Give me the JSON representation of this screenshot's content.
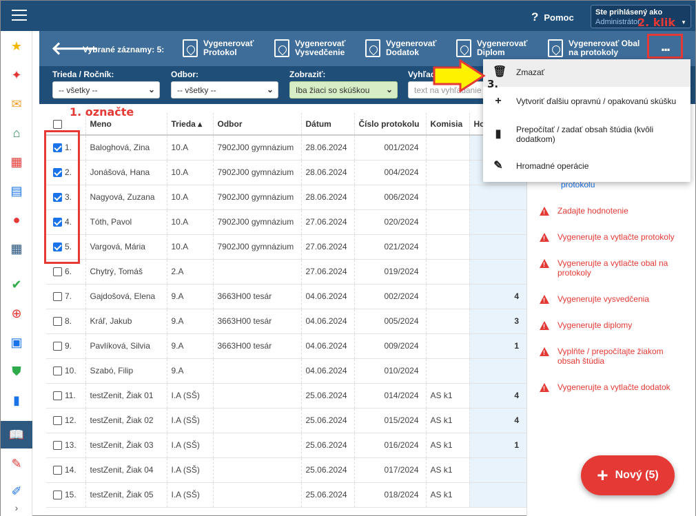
{
  "header": {
    "help_label": "Pomoc",
    "user_line1": "Ste prihlásený ako",
    "user_line2": "Administrátor"
  },
  "toolbar": {
    "selected_label": "Vybrané záznamy: 5:",
    "buttons": [
      {
        "l1": "Vygenerovať",
        "l2": "Protokol"
      },
      {
        "l1": "Vygenerovať",
        "l2": "Vysvedčenie"
      },
      {
        "l1": "Vygenerovať",
        "l2": "Dodatok"
      },
      {
        "l1": "Vygenerovať",
        "l2": "Diplom"
      },
      {
        "l1": "Vygenerovať Obal",
        "l2": "na protokoly"
      }
    ],
    "more_label": "..."
  },
  "filters": {
    "trieda_label": "Trieda / Ročník:",
    "trieda_value": "-- všetky --",
    "odbor_label": "Odbor:",
    "odbor_value": "-- všetky --",
    "zobrazit_label": "Zobraziť:",
    "zobrazit_value": "Iba žiaci so skúškou",
    "search_label": "Vyhľadá",
    "search_placeholder": "text na vyhľadanie"
  },
  "table": {
    "headers": {
      "meno": "Meno",
      "trieda": "Trieda ▴",
      "odbor": "Odbor",
      "datum": "Dátum",
      "cislo": "Číslo protokolu",
      "komisia": "Komisia",
      "ho": "Ho"
    },
    "rows": [
      {
        "n": "1.",
        "checked": true,
        "meno": "Baloghová, Zina",
        "trieda": "10.A",
        "odbor": "7902J00 gymnázium",
        "datum": "28.06.2024",
        "cislo": "001/2024",
        "komisia": "",
        "ho": ""
      },
      {
        "n": "2.",
        "checked": true,
        "meno": "Jonášová, Hana",
        "trieda": "10.A",
        "odbor": "7902J00 gymnázium",
        "datum": "28.06.2024",
        "cislo": "004/2024",
        "komisia": "",
        "ho": ""
      },
      {
        "n": "3.",
        "checked": true,
        "meno": "Nagyová, Zuzana",
        "trieda": "10.A",
        "odbor": "7902J00 gymnázium",
        "datum": "28.06.2024",
        "cislo": "006/2024",
        "komisia": "",
        "ho": ""
      },
      {
        "n": "4.",
        "checked": true,
        "meno": "Tóth, Pavol",
        "trieda": "10.A",
        "odbor": "7902J00 gymnázium",
        "datum": "27.06.2024",
        "cislo": "020/2024",
        "komisia": "",
        "ho": ""
      },
      {
        "n": "5.",
        "checked": true,
        "meno": "Vargová, Mária",
        "trieda": "10.A",
        "odbor": "7902J00 gymnázium",
        "datum": "27.06.2024",
        "cislo": "021/2024",
        "komisia": "",
        "ho": ""
      },
      {
        "n": "6.",
        "checked": false,
        "meno": "Chytrý, Tomáš",
        "trieda": "2.A",
        "odbor": "",
        "datum": "27.06.2024",
        "cislo": "019/2024",
        "komisia": "",
        "ho": ""
      },
      {
        "n": "7.",
        "checked": false,
        "meno": "Gajdošová, Elena",
        "trieda": "9.A",
        "odbor": "3663H00 tesár",
        "datum": "04.06.2024",
        "cislo": "002/2024",
        "komisia": "",
        "ho": "4"
      },
      {
        "n": "8.",
        "checked": false,
        "meno": "Kráľ, Jakub",
        "trieda": "9.A",
        "odbor": "3663H00 tesár",
        "datum": "04.06.2024",
        "cislo": "005/2024",
        "komisia": "",
        "ho": "3"
      },
      {
        "n": "9.",
        "checked": false,
        "meno": "Pavlíková, Silvia",
        "trieda": "9.A",
        "odbor": "3663H00 tesár",
        "datum": "04.06.2024",
        "cislo": "009/2024",
        "komisia": "",
        "ho": "1"
      },
      {
        "n": "10.",
        "checked": false,
        "meno": "Szabó, Filip",
        "trieda": "9.A",
        "odbor": "",
        "datum": "04.06.2024",
        "cislo": "010/2024",
        "komisia": "",
        "ho": ""
      },
      {
        "n": "11.",
        "checked": false,
        "meno": "testZenit, Žiak 01",
        "trieda": "I.A (SŠ)",
        "odbor": "",
        "datum": "25.06.2024",
        "cislo": "014/2024",
        "komisia": "AS k1",
        "ho": "4"
      },
      {
        "n": "12.",
        "checked": false,
        "meno": "testZenit, Žiak 02",
        "trieda": "I.A (SŠ)",
        "odbor": "",
        "datum": "25.06.2024",
        "cislo": "015/2024",
        "komisia": "AS k1",
        "ho": "4"
      },
      {
        "n": "13.",
        "checked": false,
        "meno": "testZenit, Žiak 03",
        "trieda": "I.A (SŠ)",
        "odbor": "",
        "datum": "25.06.2024",
        "cislo": "016/2024",
        "komisia": "AS k1",
        "ho": "1"
      },
      {
        "n": "14.",
        "checked": false,
        "meno": "testZenit, Žiak 04",
        "trieda": "I.A (SŠ)",
        "odbor": "",
        "datum": "25.06.2024",
        "cislo": "017/2024",
        "komisia": "AS k1",
        "ho": ""
      },
      {
        "n": "15.",
        "checked": false,
        "meno": "testZenit, Žiak 05",
        "trieda": "I.A (SŠ)",
        "odbor": "",
        "datum": "25.06.2024",
        "cislo": "018/2024",
        "komisia": "AS k1",
        "ho": ""
      }
    ]
  },
  "right_panel": {
    "partial": "protokolu",
    "items": [
      "Zadajte hodnotenie",
      "Vygenerujte a vytlačte protokoly",
      "Vygenerujte a vytlačte obal na protokoly",
      "Vygenerujte vysvedčenia",
      "Vygenerujte diplomy",
      "Vyplňte / prepočítajte žiakom obsah štúdia",
      "Vygenerujte a vytlačte dodatok"
    ]
  },
  "dropdown": {
    "items": [
      "Zmazať",
      "Vytvoriť ďalšiu opravnú / opakovanú skúšku",
      "Prepočítať / zadať obsah štúdia (kvôli dodatkom)",
      "Hromadné operácie"
    ]
  },
  "fab": {
    "label": "Nový (5)"
  },
  "annotations": {
    "a1": "1. označte",
    "a2": "2. klik",
    "a3": "3."
  },
  "colors": {
    "header": "#1f4e79",
    "toolbar": "#3e6d9a",
    "accent_red": "#e53935",
    "checkbox_blue": "#1a73e8"
  }
}
